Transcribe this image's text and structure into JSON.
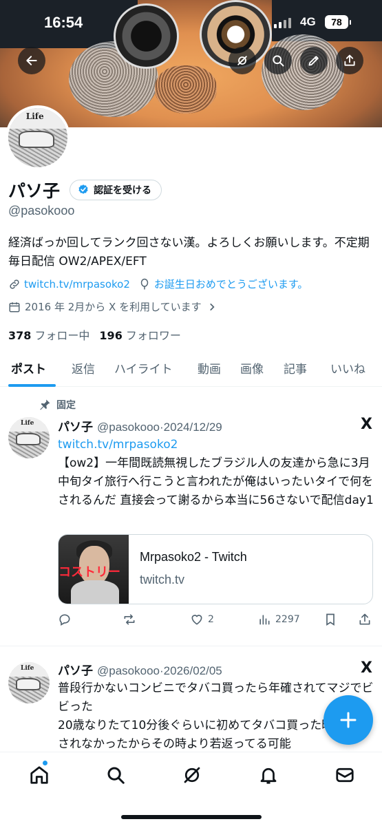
{
  "status_bar": {
    "time": "16:54",
    "network": "4G",
    "battery": "78"
  },
  "profile": {
    "display_name": "パソ子",
    "verify_label": "認証を受ける",
    "handle": "@pasokooo",
    "bio": "経済ばっか回してランク回さない漢。よろしくお願いします。不定期毎日配信 OW2/APEX/EFT",
    "link": "twitch.tv/mrpasoko2",
    "birthday": "お誕生日おめでとうございます。",
    "joined": "2016 年 2月から X を利用しています",
    "following_count": "378",
    "following_label": "フォロー中",
    "followers_count": "196",
    "followers_label": "フォロワー",
    "avatar_text": "Life"
  },
  "tabs": [
    "ポスト",
    "返信",
    "ハイライト",
    "動画",
    "画像",
    "記事",
    "いいね"
  ],
  "posts": [
    {
      "pinned_label": "固定",
      "name": "パソ子",
      "handle": "@pasokooo",
      "separator": "·",
      "date": "2024/12/29",
      "link": "twitch.tv/mrpasoko2",
      "text": "【ow2】一年間既読無視したブラジル人の友達から急に3月中旬タイ旅行へ行こうと言われたが俺はいったいタイで何をされるんだ 直接会って謝るから本当に56さないで配信day1",
      "card": {
        "title": "Mrpasoko2 - Twitch",
        "domain": "twitch.tv",
        "thumb_text": "コストリー"
      },
      "likes": "2",
      "views": "2297",
      "x_logo": "X"
    },
    {
      "name": "パソ子",
      "handle": "@pasokooo",
      "separator": "·",
      "date": "2026/02/05",
      "text_line1": "普段行かないコンビニでタバコ買ったら年確されてマジでビビった",
      "text_line2": "20歳なりたて10分後ぐらいに初めてタバコ買った時は年確されなかったからその時より若返ってる可能",
      "x_logo": "X"
    }
  ],
  "colors": {
    "accent": "#1d9bf0",
    "text": "#0f1419",
    "secondary": "#536471"
  }
}
